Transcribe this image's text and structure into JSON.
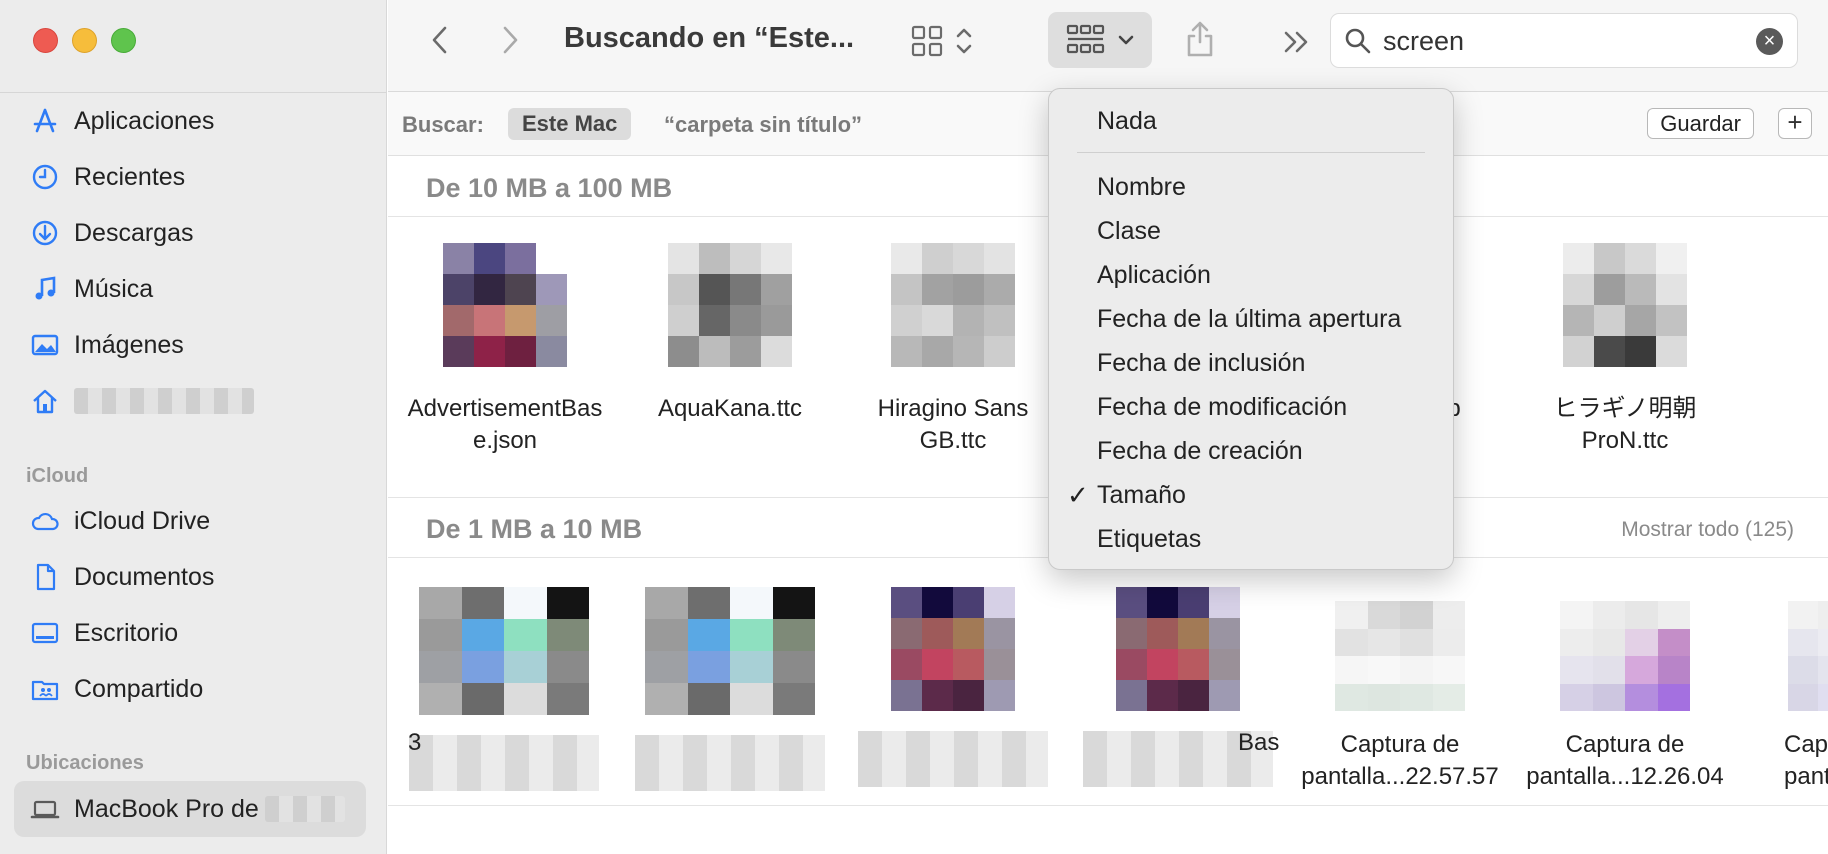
{
  "window": {
    "title": "Buscando en “Este..."
  },
  "sidebar": {
    "favorites": [
      {
        "label": "Aplicaciones",
        "icon": "apps-icon"
      },
      {
        "label": "Recientes",
        "icon": "clock-icon"
      },
      {
        "label": "Descargas",
        "icon": "download-icon"
      },
      {
        "label": "Música",
        "icon": "music-icon"
      },
      {
        "label": "Imágenes",
        "icon": "photo-icon"
      }
    ],
    "icloud_header": "iCloud",
    "icloud": [
      {
        "label": "iCloud Drive",
        "icon": "cloud-icon"
      },
      {
        "label": "Documentos",
        "icon": "document-icon"
      },
      {
        "label": "Escritorio",
        "icon": "desktop-icon"
      },
      {
        "label": "Compartido",
        "icon": "shared-folder-icon"
      }
    ],
    "locations_header": "Ubicaciones",
    "locations": [
      {
        "label": "MacBook Pro de",
        "icon": "laptop-icon"
      }
    ]
  },
  "search": {
    "value": "screen"
  },
  "scope": {
    "label": "Buscar:",
    "selected": "Este Mac",
    "other": "“carpeta sin título”",
    "save": "Guardar",
    "add": "+"
  },
  "sections": [
    {
      "title": "De 10 MB a 100 MB",
      "files": [
        {
          "line1": "AdvertisementBas",
          "line2": "e.json"
        },
        {
          "line1": "AquaKana.ttc",
          "line2": ""
        },
        {
          "line1": "Hiragino Sans",
          "line2": "GB.ttc"
        },
        {
          "line1": "zip",
          "line2": ""
        },
        {
          "line1": "ヒラギノ明朝",
          "line2": "ProN.ttc"
        }
      ]
    },
    {
      "title": "De 1 MB a 10 MB",
      "show_all": "Mostrar todo (125)",
      "files": [
        {
          "line1": "3",
          "line2": ""
        },
        {
          "line1": "Bas",
          "line2": ""
        },
        {
          "line1": "Captura de",
          "line2": "pantalla...22.57.57"
        },
        {
          "line1": "Captura de",
          "line2": "pantalla...12.26.04"
        },
        {
          "line1": "Cap",
          "line2": "pantalla"
        }
      ]
    }
  ],
  "group_menu": {
    "items": [
      {
        "label": "Nada",
        "checked": false
      },
      {
        "label": "Nombre",
        "checked": false
      },
      {
        "label": "Clase",
        "checked": false
      },
      {
        "label": "Aplicación",
        "checked": false
      },
      {
        "label": "Fecha de la última apertura",
        "checked": false
      },
      {
        "label": "Fecha de inclusión",
        "checked": false
      },
      {
        "label": "Fecha de modificación",
        "checked": false
      },
      {
        "label": "Fecha de creación",
        "checked": false
      },
      {
        "label": "Tamaño",
        "checked": true
      },
      {
        "label": "Etiquetas",
        "checked": false
      }
    ],
    "checkmark": "✓"
  },
  "colors": {
    "accent": "#2f7cf6",
    "close": "#ee5b52",
    "minimize": "#f6bd3b",
    "maximize": "#5fc44d"
  }
}
